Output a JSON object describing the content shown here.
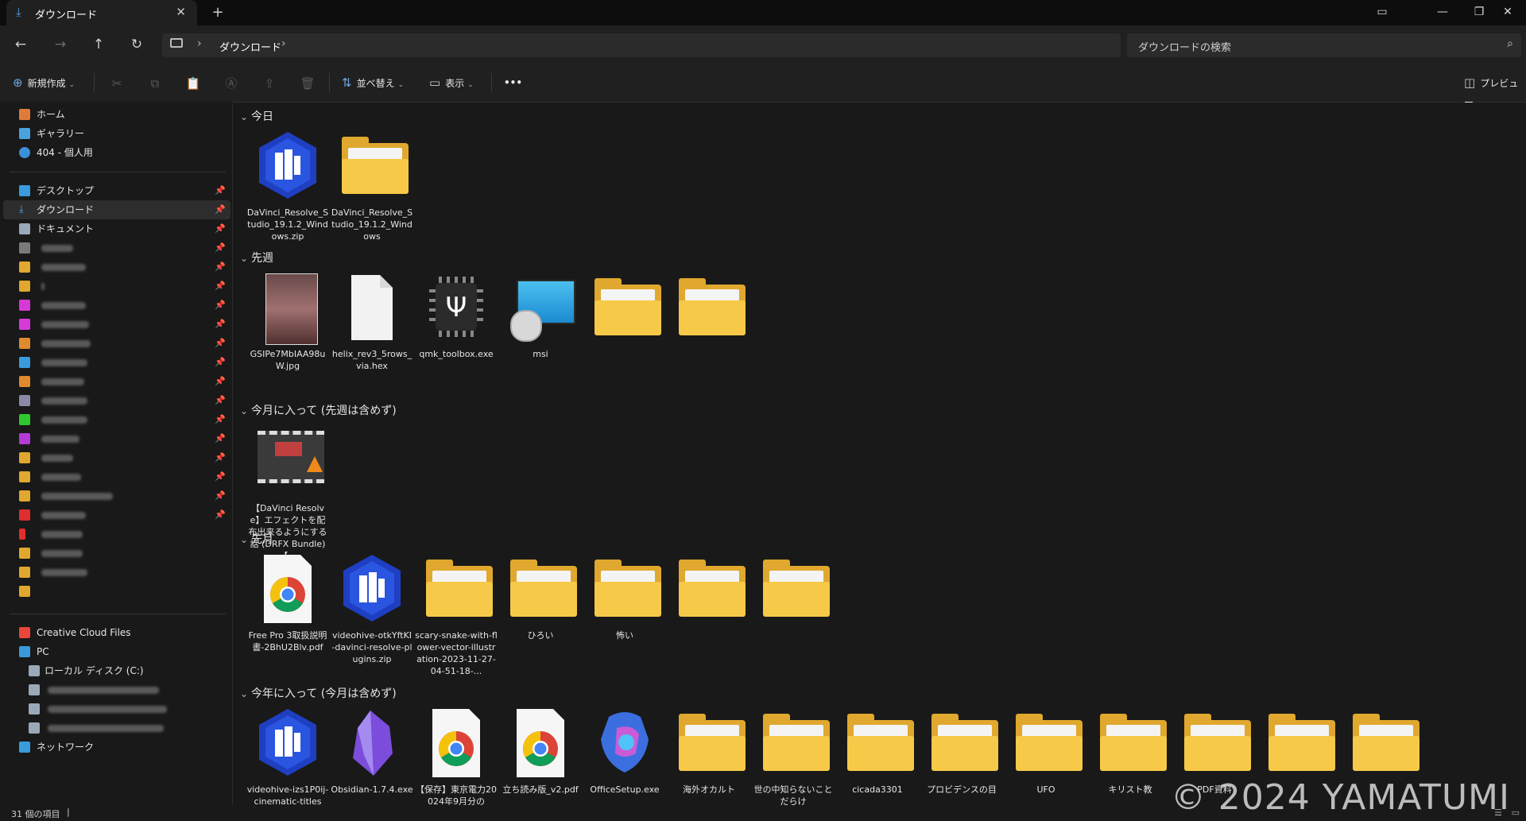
{
  "window": {
    "tab_title": "ダウンロード",
    "tab_close": "✕",
    "new_tab": "+",
    "minimize": "—",
    "restore": "❐",
    "close": "✕"
  },
  "address": {
    "crumb": "ダウンロード",
    "separator": "›",
    "search_placeholder": "ダウンロードの検索"
  },
  "toolbar": {
    "new_label": "新規作成",
    "sort_label": "並べ替え",
    "view_label": "表示",
    "more_label": "•••",
    "preview_label": "プレビュー"
  },
  "sidebar": {
    "quick": [
      {
        "label": "ホーム",
        "icon": "home-icon",
        "color": "#e07b39"
      },
      {
        "label": "ギャラリー",
        "icon": "gallery-icon",
        "color": "#4aa3df"
      },
      {
        "label": "404 - 個人用",
        "icon": "onedrive-icon",
        "color": "#3c8fdb"
      }
    ],
    "pinned": [
      {
        "label": "デスクトップ",
        "icon": "desktop-icon",
        "color": "#3a9bdc"
      },
      {
        "label": "ダウンロード",
        "icon": "download-icon",
        "color": "#4ea3e8"
      },
      {
        "label": "ドキュメント",
        "icon": "document-icon",
        "color": "#9aa9b8"
      }
    ],
    "bottom": [
      {
        "label": "Creative Cloud Files",
        "icon": "creative-cloud-icon",
        "color": "#e8463a"
      },
      {
        "label": "PC",
        "icon": "pc-icon",
        "color": "#3a9bdc"
      },
      {
        "label": "ローカル ディスク (C:)",
        "icon": "disk-icon",
        "color": "#9aa9b8"
      },
      {
        "label": "ネットワーク",
        "icon": "network-icon",
        "color": "#3a9bdc"
      }
    ],
    "pin_glyph": "📌"
  },
  "groups": {
    "today": {
      "title": "今日",
      "items": [
        {
          "name": "DaVinci_Resolve_Studio_19.1.2_Windows.zip",
          "type": "davinci"
        },
        {
          "name": "DaVinci_Resolve_Studio_19.1.2_Windows",
          "type": "folder"
        }
      ]
    },
    "last_week": {
      "title": "先週",
      "items": [
        {
          "name": "GSIPe7MbIAA98uW.jpg",
          "type": "image"
        },
        {
          "name": "helix_rev3_5rows_via.hex",
          "type": "file"
        },
        {
          "name": "qmk_toolbox.exe",
          "type": "qmk"
        },
        {
          "name": "msi",
          "type": "msi"
        },
        {
          "name": "",
          "type": "folder"
        },
        {
          "name": "",
          "type": "folder"
        }
      ]
    },
    "this_month": {
      "title": "今月に入って (先週は含めず)",
      "items": [
        {
          "name": "【DaVinci Resolve】エフェクトを配布出来るようにする話 (DRFX Bundle)【...",
          "type": "video"
        }
      ]
    },
    "last_month": {
      "title": "先月",
      "items": [
        {
          "name": "Free Pro 3取扱説明書-2BhU2Blv.pdf",
          "type": "pdf"
        },
        {
          "name": "videohive-otkYftKI-davinci-resolve-plugins.zip",
          "type": "davinci"
        },
        {
          "name": "scary-snake-with-flower-vector-illustration-2023-11-27-04-51-18-...",
          "type": "folder"
        },
        {
          "name": "ひろい",
          "type": "folder"
        },
        {
          "name": "怖い",
          "type": "folder"
        },
        {
          "name": "",
          "type": "folder"
        },
        {
          "name": "",
          "type": "folder"
        }
      ]
    },
    "this_year": {
      "title": "今年に入って (今月は含めず)",
      "items": [
        {
          "name": "videohive-izs1P0ij-cinematic-titles",
          "type": "davinci"
        },
        {
          "name": "Obsidian-1.7.4.exe",
          "type": "obsidian"
        },
        {
          "name": "【保存】東京電力20024年9月分の",
          "type": "pdf"
        },
        {
          "name": "立ち読み版_v2.pdf",
          "type": "pdf"
        },
        {
          "name": "OfficeSetup.exe",
          "type": "office"
        },
        {
          "name": "海外オカルト",
          "type": "folder"
        },
        {
          "name": "世の中知らないことだらけ",
          "type": "folder"
        },
        {
          "name": "cicada3301",
          "type": "folder"
        },
        {
          "name": "プロビデンスの目",
          "type": "folder"
        },
        {
          "name": "UFO",
          "type": "folder"
        },
        {
          "name": "キリスト教",
          "type": "folder"
        },
        {
          "name": "PDF資料",
          "type": "folder"
        },
        {
          "name": "",
          "type": "folder"
        },
        {
          "name": "",
          "type": "folder"
        }
      ]
    }
  },
  "status": {
    "item_count": "31 個の項目",
    "sep": "|"
  },
  "watermark": "© 2024 YAMATUMI"
}
